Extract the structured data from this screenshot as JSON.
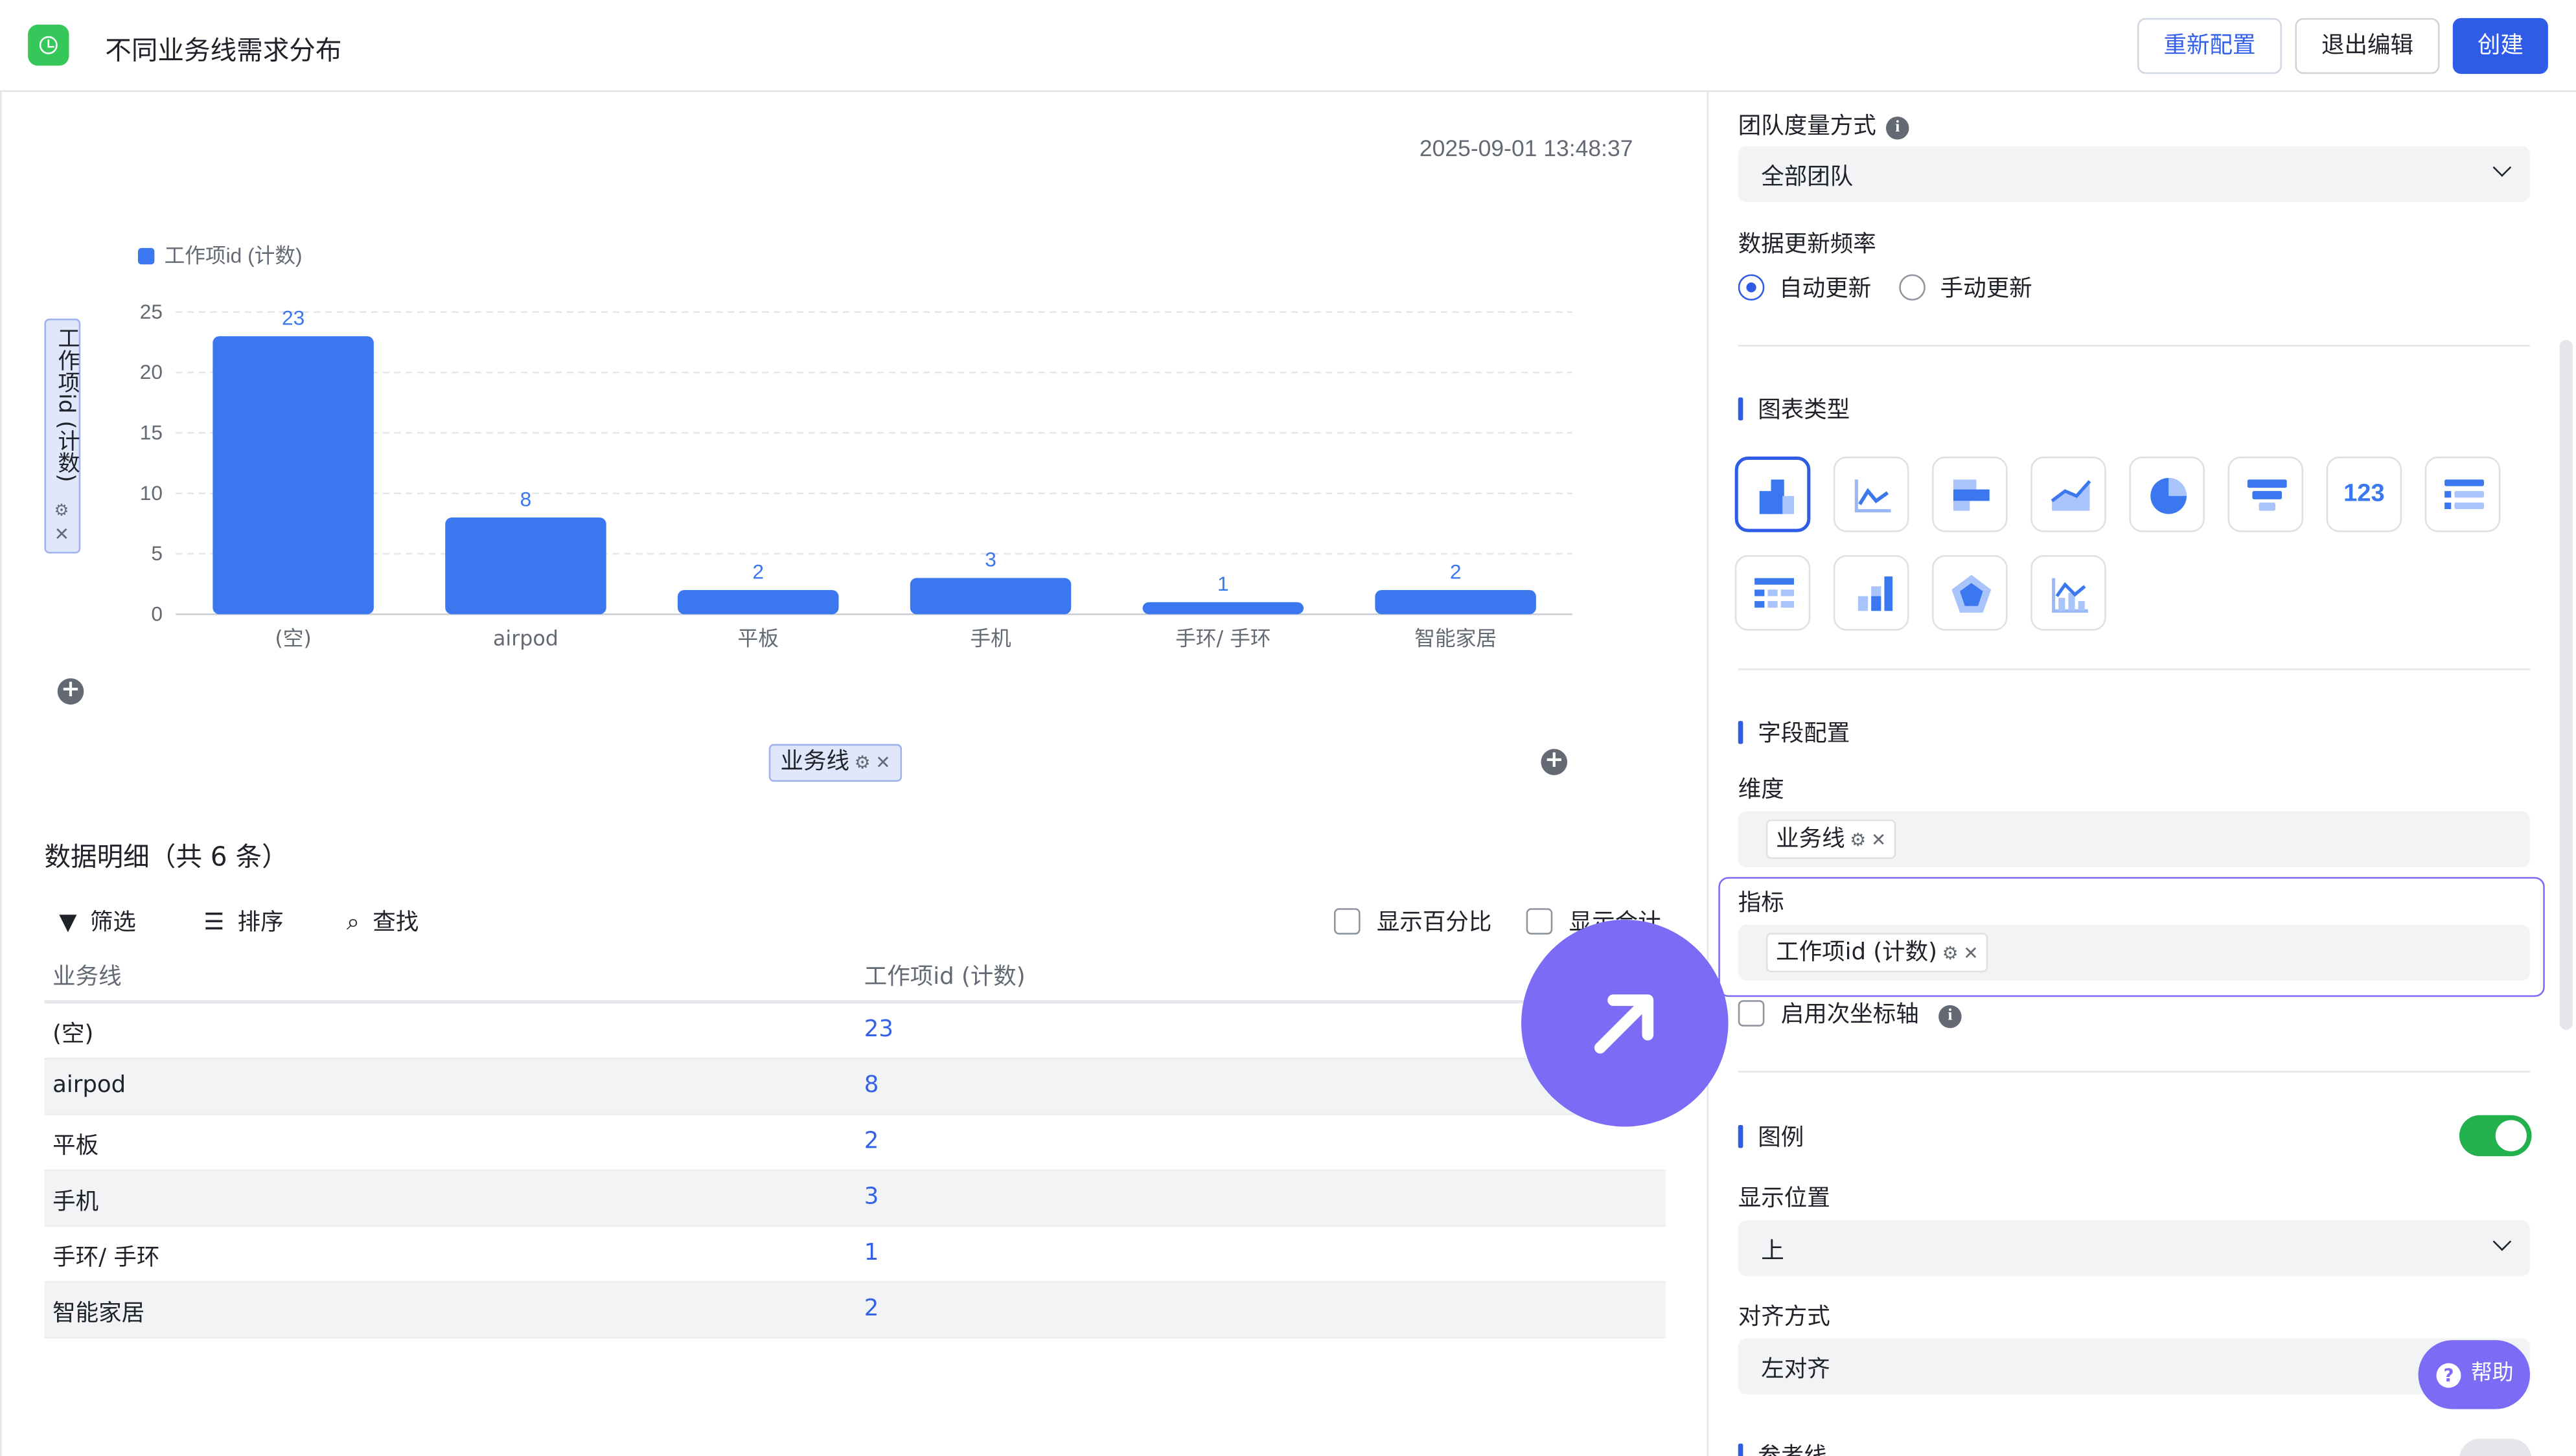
{
  "header": {
    "title": "不同业务线需求分布",
    "reset_label": "重新配置",
    "exit_label": "退出编辑",
    "create_label": "创建",
    "app_icon": "clock-icon",
    "accent": "#2f5ce6"
  },
  "chart_panel": {
    "timestamp": "2025-09-01 13:48:37",
    "y_field_tag": "工作项id (计数)",
    "x_field_tag": "业务线"
  },
  "chart_data": {
    "type": "bar",
    "categories": [
      "(空)",
      "airpod",
      "平板",
      "手机",
      "手环/ 手环",
      "智能家居"
    ],
    "series": [
      {
        "name": "工作项id (计数)",
        "values": [
          23,
          8,
          2,
          3,
          1,
          2
        ],
        "color": "#3b78f0"
      }
    ],
    "yticks": [
      0,
      5,
      10,
      15,
      20,
      25
    ],
    "ylim": [
      0,
      25
    ],
    "ylabel": "工作项id (计数)",
    "xlabel": "业务线",
    "legend": "top-left",
    "grid": true
  },
  "detail": {
    "title": "数据明细（共 6 条）",
    "filter_label": "筛选",
    "sort_label": "排序",
    "find_label": "查找",
    "show_percent_label": "显示百分比",
    "show_total_label": "显示合计",
    "columns": [
      "业务线",
      "工作项id (计数)"
    ],
    "rows": [
      [
        "(空)",
        "23"
      ],
      [
        "airpod",
        "8"
      ],
      [
        "平板",
        "2"
      ],
      [
        "手机",
        "3"
      ],
      [
        "手环/ 手环",
        "1"
      ],
      [
        "智能家居",
        "2"
      ]
    ]
  },
  "settings": {
    "team_measure_label": "团队度量方式",
    "team_measure_value": "全部团队",
    "refresh_label": "数据更新频率",
    "refresh_auto": "自动更新",
    "refresh_manual": "手动更新",
    "refresh_selected": "自动更新",
    "chart_type_title": "图表类型",
    "chart_types": [
      "column-chart-icon",
      "line-chart-icon",
      "bar-chart-icon",
      "area-chart-icon",
      "pie-chart-icon",
      "funnel-chart-icon",
      "number-card-icon",
      "list-chart-icon",
      "table-chart-icon",
      "stacked-column-icon",
      "radar-chart-icon",
      "combo-chart-icon"
    ],
    "number_card_text": "123",
    "field_config_title": "字段配置",
    "dimension_label": "维度",
    "dimension_chip": "业务线",
    "metric_label": "指标",
    "metric_chip": "工作项id (计数)",
    "secondary_axis_label": "启用次坐标轴",
    "legend_title": "图例",
    "legend_enabled": true,
    "position_label": "显示位置",
    "position_value": "上",
    "align_label": "对齐方式",
    "align_value": "左对齐",
    "reference_line_title": "参考线",
    "help_label": "帮助"
  }
}
